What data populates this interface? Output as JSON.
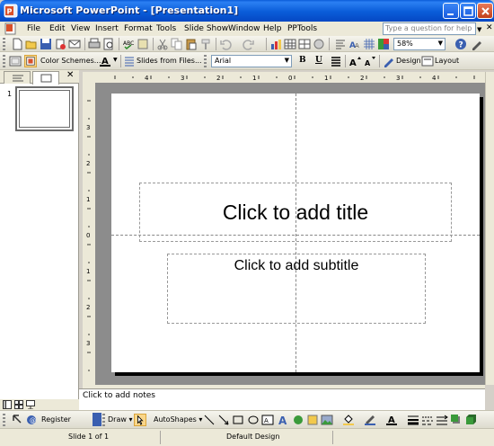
{
  "window": {
    "title": "Microsoft PowerPoint - [Presentation1]"
  },
  "menu": {
    "items": [
      {
        "label": "File",
        "underline": "F"
      },
      {
        "label": "Edit",
        "underline": "E"
      },
      {
        "label": "View",
        "underline": "V"
      },
      {
        "label": "Insert",
        "underline": "I"
      },
      {
        "label": "Format",
        "underline": "o"
      },
      {
        "label": "Tools",
        "underline": "T"
      },
      {
        "label": "Slide Show",
        "underline": "d"
      },
      {
        "label": "Window",
        "underline": "W"
      },
      {
        "label": "Help",
        "underline": "H"
      },
      {
        "label": "PPTools",
        "underline": ""
      }
    ],
    "help_placeholder": "Type a question for help"
  },
  "standard_toolbar": {
    "zoom": "58%"
  },
  "formatting_toolbar": {
    "color_schemes": "Color Schemes...",
    "slides_from_files": "Slides from Files...",
    "font": "Arial",
    "bold": "B",
    "underline": "U",
    "design": "Design",
    "layout": "Layout"
  },
  "slides_pane": {
    "slide_number": "1"
  },
  "slide": {
    "title_placeholder": "Click to add title",
    "subtitle_placeholder": "Click to add subtitle"
  },
  "notes": {
    "placeholder": "Click to add notes"
  },
  "drawing_toolbar": {
    "register": "Register",
    "draw": "Draw",
    "autoshapes": "AutoShapes"
  },
  "status": {
    "slide_info": "Slide 1 of 1",
    "design_name": "Default Design"
  },
  "colors": {
    "title_bar": "#0a5cd8",
    "chrome": "#ece9d8",
    "workspace": "#8c8c8c"
  }
}
